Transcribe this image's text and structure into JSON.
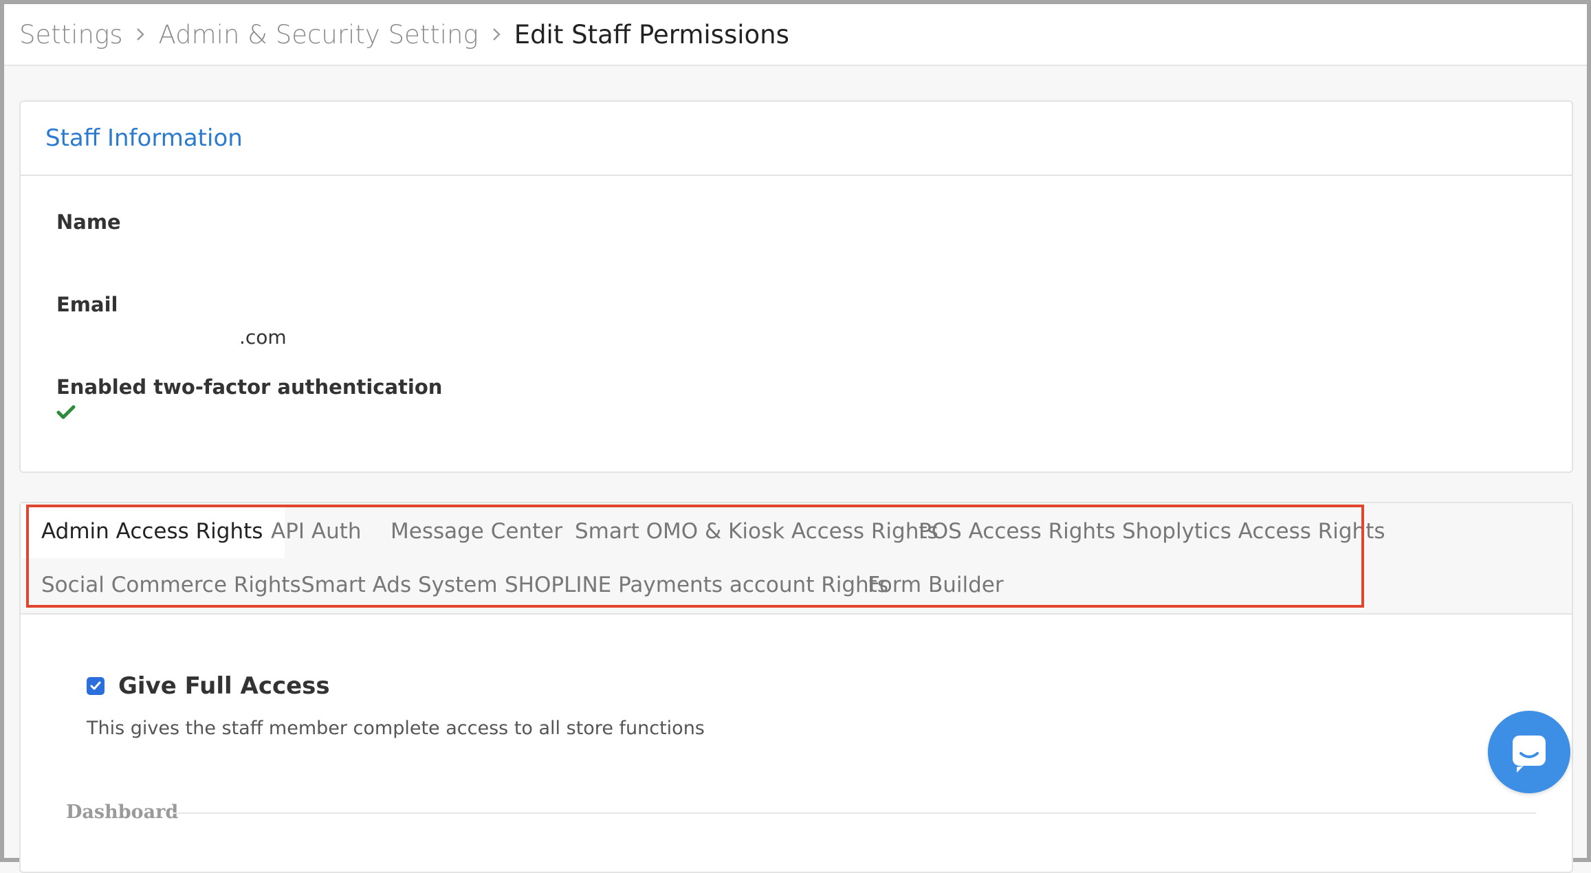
{
  "breadcrumb": {
    "items": [
      "Settings",
      "Admin & Security Setting",
      "Edit Staff Permissions"
    ]
  },
  "staff_info": {
    "title": "Staff Information",
    "name_label": "Name",
    "name_value": "",
    "email_label": "Email",
    "email_value": ".com",
    "two_factor_label": "Enabled two-factor authentication",
    "two_factor_icon": "check-icon"
  },
  "tabs": [
    {
      "label": "Admin Access Rights",
      "active": true
    },
    {
      "label": "API Auth"
    },
    {
      "label": "Message Center"
    },
    {
      "label": "Smart OMO & Kiosk Access Rights"
    },
    {
      "label": "POS Access Rights"
    },
    {
      "label": "Shoplytics Access Rights"
    },
    {
      "label": "Social Commerce Rights"
    },
    {
      "label": "Smart Ads System"
    },
    {
      "label": "SHOPLINE Payments account Rights"
    },
    {
      "label": "Form Builder"
    }
  ],
  "full_access": {
    "checked": true,
    "title": "Give Full Access",
    "description": "This gives the staff member complete access to all store functions"
  },
  "section": {
    "label": "Dashboard"
  },
  "colors": {
    "accent": "#2a7bd0",
    "highlight_border": "#e0452f",
    "chat_button": "#3d8fe6",
    "check": "#2e8b3a"
  }
}
